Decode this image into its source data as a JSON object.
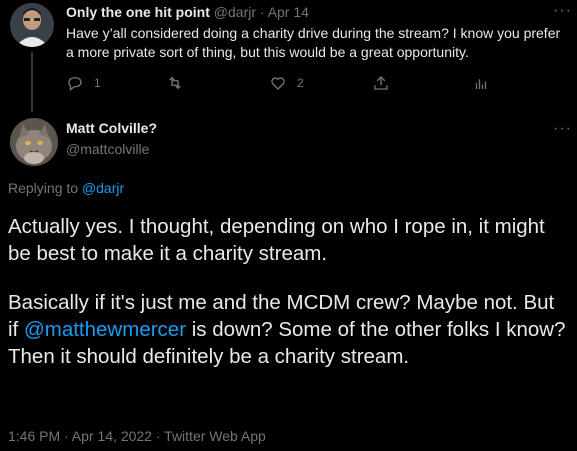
{
  "reply_tweet": {
    "author_name": "Only the one hit point",
    "handle": "@darjr",
    "separator": "·",
    "date": "Apr 14",
    "text": "Have y’all considered doing a charity drive during the stream? I know you prefer a more private sort of thing, but this would be a great opportunity.",
    "more_icon": "ellipsis-icon",
    "actions": {
      "reply_count": "1",
      "retweet_count": "",
      "like_count": "2"
    }
  },
  "main_tweet": {
    "author_name": "Matt Colville?",
    "handle": "@mattcolville",
    "more_icon": "ellipsis-icon",
    "replying_to_label": "Replying to",
    "replying_to_handle": "@darjr",
    "paragraph1": "Actually yes. I thought, depending on who I rope in, it might be best to make it a charity stream.",
    "paragraph2_before": "Basically if it's just me and the MCDM crew? Maybe not. But if ",
    "paragraph2_mention": "@matthewmercer",
    "paragraph2_after": " is down? Some of the other folks I know? Then it should definitely be a charity stream.",
    "timestamp": "1:46 PM · Apr 14, 2022 · Twitter Web App"
  },
  "colors": {
    "background": "#000000",
    "text": "#e7e9ea",
    "secondary": "#71767b",
    "link": "#1d9bf0"
  }
}
